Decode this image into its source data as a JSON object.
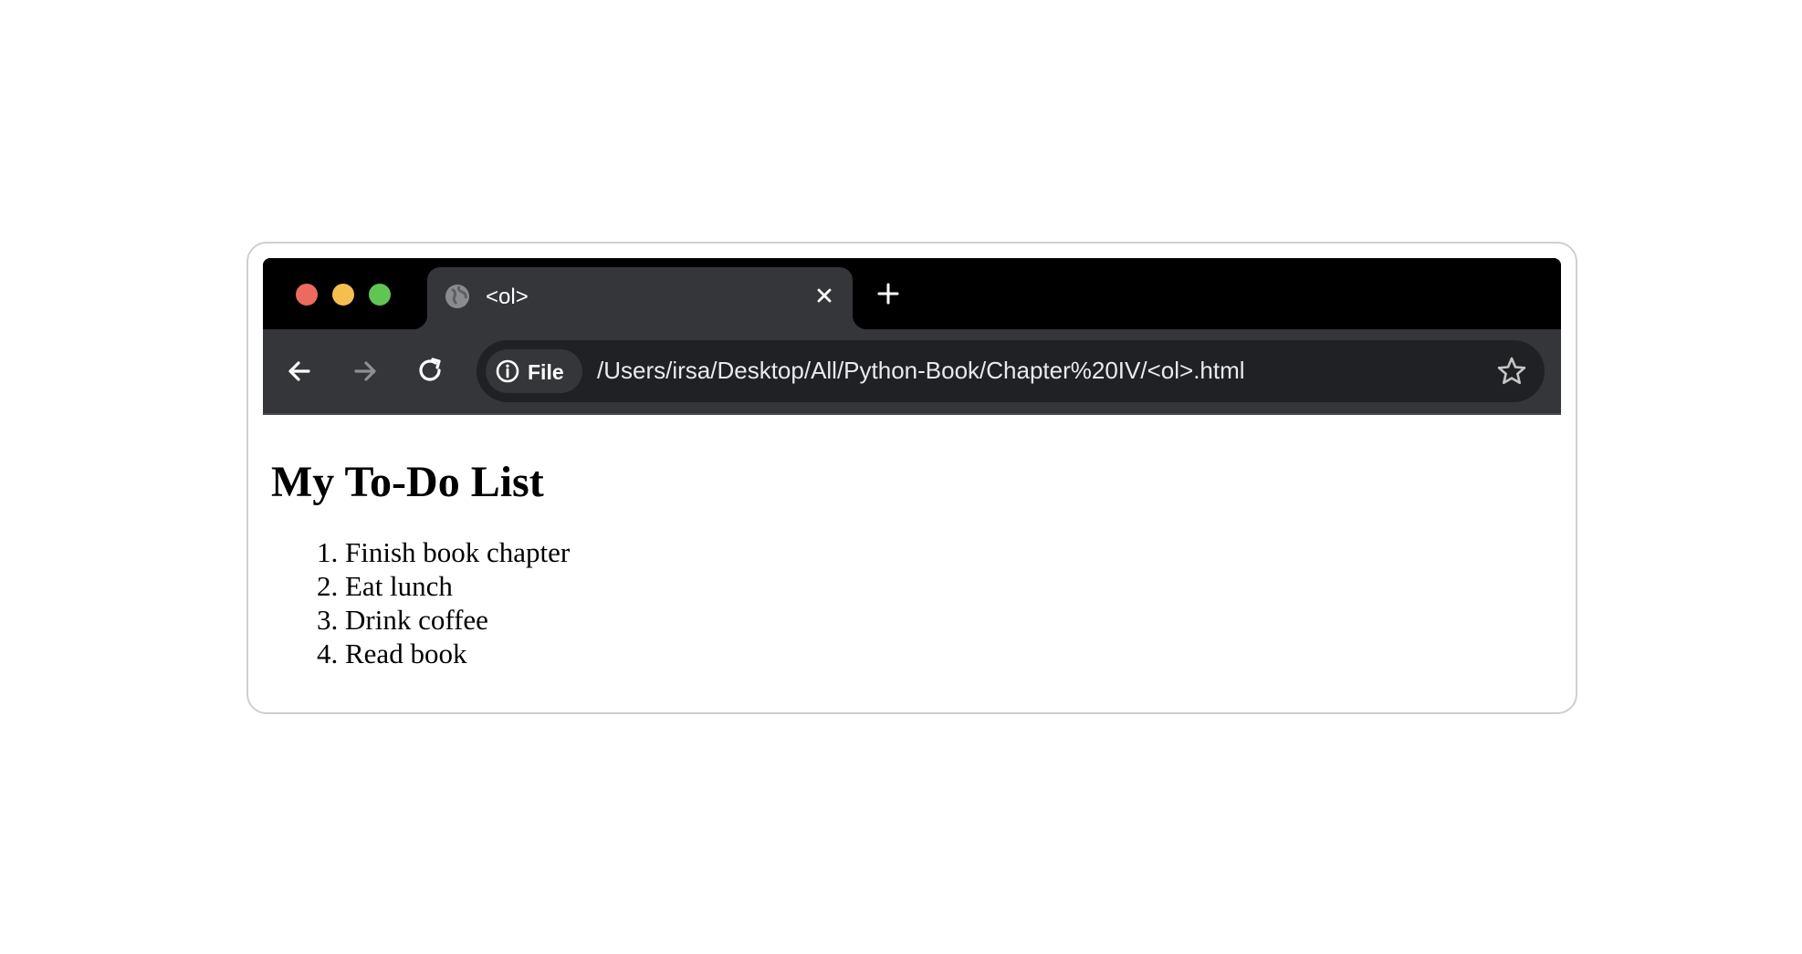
{
  "browser": {
    "tab": {
      "title": "<ol>"
    },
    "address_bar": {
      "scheme_chip": "File",
      "url": "/Users/irsa/Desktop/All/Python-Book/Chapter%20IV/<ol>.html"
    }
  },
  "page": {
    "heading": "My To-Do List",
    "items": [
      "Finish book chapter",
      "Eat lunch",
      "Drink coffee",
      "Read book"
    ]
  },
  "colors": {
    "traffic_red": "#ec6a5e",
    "traffic_yellow": "#f4bf4f",
    "traffic_green": "#61c554",
    "toolbar": "#35363a",
    "omnibox": "#202124"
  }
}
